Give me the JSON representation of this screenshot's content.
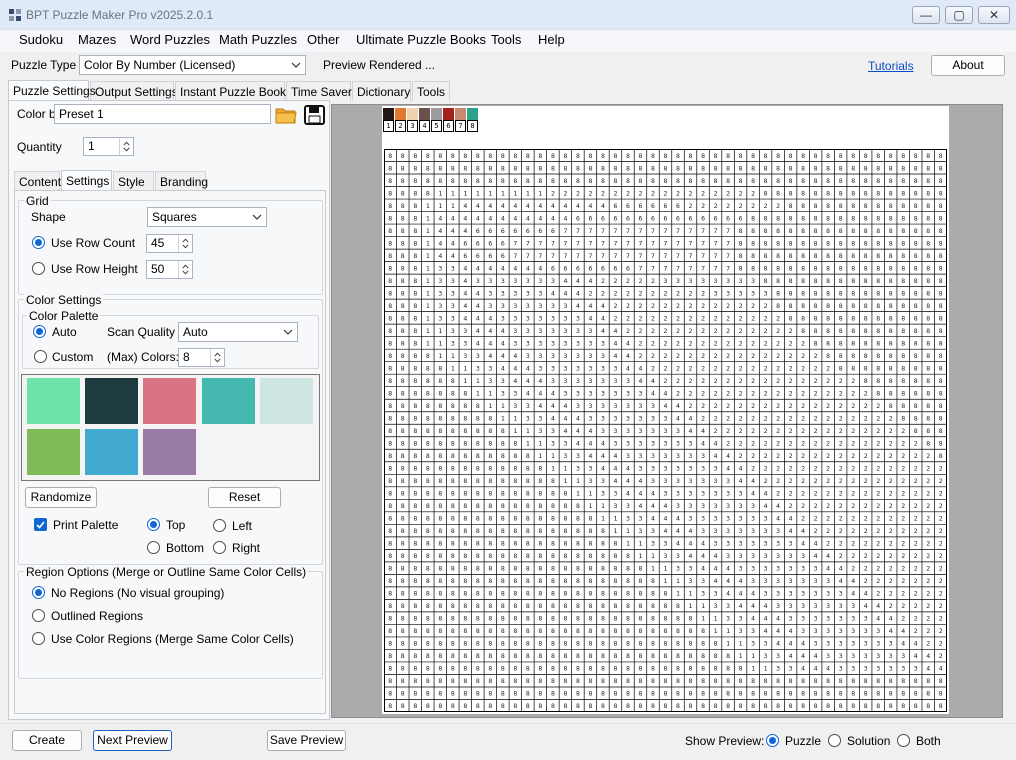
{
  "window": {
    "title": "BPT Puzzle Maker Pro v2025.2.0.1",
    "minimize_label": "—",
    "maximize_label": "▢",
    "close_label": "✕"
  },
  "menu": [
    "Sudoku",
    "Mazes",
    "Word Puzzles",
    "Math Puzzles",
    "Other",
    "Ultimate Puzzle Books",
    "Tools",
    "Help"
  ],
  "toolbar": {
    "puzzle_type_label": "Puzzle Type",
    "puzzle_type_value": "Color By Number (Licensed)",
    "status": "Preview Rendered ...",
    "tutorials_link": "Tutorials",
    "about_label": "About"
  },
  "main_tabs": [
    "Puzzle Settings",
    "Output Settings",
    "Instant Puzzle Books",
    "Time Saver",
    "Dictionary",
    "Tools"
  ],
  "color_by": {
    "label": "Color by",
    "value": "Preset 1"
  },
  "quantity": {
    "label": "Quantity",
    "value": "1"
  },
  "sub_tabs": [
    "Content",
    "Settings",
    "Style",
    "Branding"
  ],
  "grid_group": {
    "title": "Grid",
    "shape_label": "Shape",
    "shape_value": "Squares",
    "row_count_label": "Use Row Count",
    "row_count_value": "45",
    "row_height_label": "Use Row Height",
    "row_height_value": "50"
  },
  "color_settings": {
    "title": "Color Settings",
    "palette_title": "Color Palette",
    "auto_label": "Auto",
    "custom_label": "Custom",
    "scan_quality_label": "Scan Quality",
    "scan_quality_value": "Auto",
    "max_colors_label": "(Max) Colors:",
    "max_colors_value": "8",
    "swatches": [
      "#6ee3a9",
      "#1e3b3f",
      "#d97582",
      "#45b8b0",
      "#cde6e2",
      "#7fbb57",
      "#41a9d0",
      "#9a7ba4"
    ],
    "randomize_label": "Randomize",
    "reset_label": "Reset",
    "print_palette_label": "Print Palette",
    "top_label": "Top",
    "left_label": "Left",
    "bottom_label": "Bottom",
    "right_label": "Right"
  },
  "region_options": {
    "title": "Region Options (Merge or Outline Same Color Cells)",
    "no_regions": "No Regions (No visual grouping)",
    "outlined": "Outlined Regions",
    "color_regions": "Use Color Regions (Merge Same Color Cells)"
  },
  "preview": {
    "palette_colors": [
      "#231815",
      "#e07a2f",
      "#f2d3b0",
      "#6b4f4a",
      "#9b9b9b",
      "#a3221e",
      "#c98872",
      "#2aa38a"
    ],
    "palette_numbers": [
      "1",
      "2",
      "3",
      "4",
      "5",
      "6",
      "7",
      "8"
    ],
    "grid_rows": 45,
    "grid_cols": 45,
    "grid_row_strings": [
      "888888888888888888888888888888888888888888888",
      "888888888888888888888888888888888888888888888",
      "888888888888888888888888888888888888888888888",
      "888811111111122222222222222222888888888888888",
      "888111444444444444666666222222228888888888888",
      "888144444444444666666666666668888888888888888",
      "888144466666667777777777777788888888888888888",
      "888144666677777777777777777788888888888888888",
      "888144666677777777777777777788888888888888888",
      "888133444444466666667777777788888888888888888",
      "888133433333334442222233333333888888888888888",
      "888133443333344422222222223333388888888888888",
      "888133443333333444222222222222288888888888888",
      "888133444333333344222222222222228888888888888",
      "888113344433333334422222222222222888888888888",
      "888113344433333333442222222222222288888888888",
      "888811334443333333442222222222222228888888888",
      "888881133444333333344222222222222222888888888",
      "888888113344433333334422222222222222228888888",
      "888888811334443333333442222222222222222888888",
      "888888881133444333333344222222222222222288888",
      "888888888113344433333334422222222222222228888",
      "888888888811334443333333442222222222222222888",
      "888888888881133444333333344222222222222222288",
      "888888888888113344433333334422222222222222228",
      "888888888888811334443333333442222222222222222",
      "888888888888881133444333333344222222222222222",
      "888888888888888113344433333334422222222222222",
      "888888888888888811334443333333442222222222222",
      "888888888888888881133444333333344222222222222",
      "888888888888888888113344433333334422222222222",
      "888888888888888888811334443333333442222222222",
      "888888888888888888881133444333333344222222222",
      "888888888888888888888113344433333334422222222",
      "888888888888888888888811334443333333442222222",
      "888888888888888888888881133444333333344222222",
      "888888888888888888888888113344433333334422222",
      "888888888888888888888888811334443333333442222",
      "888888888888888888888888881133444333333344222",
      "888888888888888888888888888113344433333334422",
      "888888888888888888888888888811334443333333442",
      "888888888888888888888888888881133444333333344",
      "888888888888888888888888888888888888888888888",
      "888888888888888888888888888888888888888888888",
      "888888888888888888888888888888888888888888888"
    ]
  },
  "bottom": {
    "create_label": "Create",
    "next_preview_label": "Next Preview",
    "save_preview_label": "Save Preview",
    "show_preview_label": "Show Preview:",
    "puzzle_label": "Puzzle",
    "solution_label": "Solution",
    "both_label": "Both"
  }
}
